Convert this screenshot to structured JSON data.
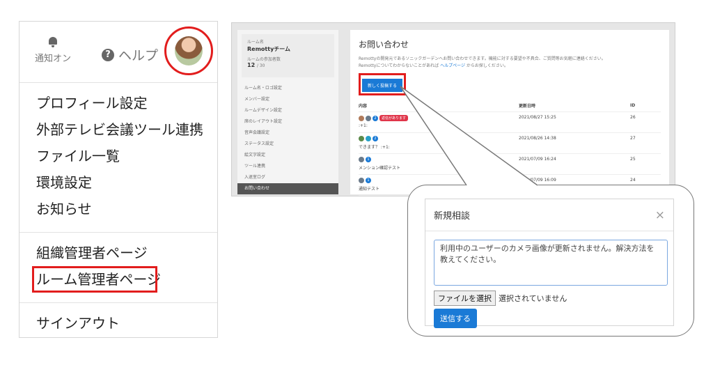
{
  "user_menu": {
    "notifications_label": "通知オン",
    "help_label": "ヘルプ",
    "groups": [
      [
        "プロフィール設定",
        "外部テレビ会議ツール連携",
        "ファイル一覧",
        "環境設定",
        "お知らせ"
      ],
      [
        "組織管理者ページ",
        "ルーム管理者ページ"
      ],
      [
        "サインアウト"
      ]
    ]
  },
  "admin": {
    "room_label": "ルーム名",
    "room_name": "Remottyチーム",
    "members_label": "ルームの参加者数",
    "members_count": "12",
    "members_max": "/ 30",
    "sidebar": [
      "ルーム名・ロゴ設定",
      "メンバー設定",
      "ルームデザイン設定",
      "席のレイアウト設定",
      "音声会議設定",
      "ステータス設定",
      "絵文字設定",
      "ツール連携",
      "入退室ログ",
      "お問い合わせ"
    ],
    "title": "お問い合わせ",
    "desc1": "Remottyの開発元であるソニックガーデンへお問い合わせできます。機能に対する要望や不具合、ご質問等お気軽に連絡ください。",
    "desc2_pre": "Remottyについてわからないことがあれば",
    "desc2_link": "ヘルプページ",
    "desc2_post": "からお探しください。",
    "new_post_label": "新しく投稿する",
    "columns": [
      "内容",
      "更新日時",
      "ID"
    ],
    "rows": [
      {
        "badge": "2",
        "chip": "返信があります",
        "text": ":+1:",
        "date": "2021/08/27 15:25",
        "id": "26"
      },
      {
        "badge": "2",
        "chip": "",
        "text": "できます？ :+1:",
        "date": "2021/08/26 14:38",
        "id": "27"
      },
      {
        "badge": "1",
        "chip": "",
        "text": "メンション確認テスト",
        "date": "2021/07/09 16:24",
        "id": "25"
      },
      {
        "badge": "1",
        "chip": "",
        "text": "通知テスト",
        "date": "2021/07/09 16:09",
        "id": "24"
      }
    ]
  },
  "modal": {
    "title": "新規相談",
    "message": "利用中のユーザーのカメラ画像が更新されません。解決方法を教えてください。",
    "file_button": "ファイルを選択",
    "file_status": "選択されていません",
    "submit_label": "送信する"
  },
  "colors": {
    "accent": "#1a7ad6",
    "highlight": "#e21d1d"
  }
}
